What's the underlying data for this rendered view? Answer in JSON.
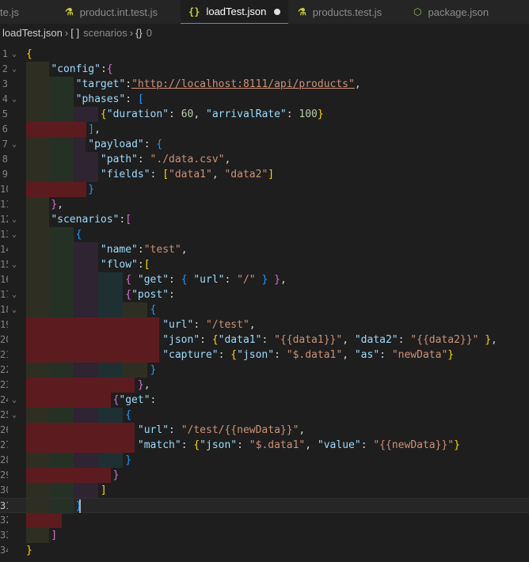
{
  "tabs": [
    {
      "label": "te.js",
      "icon": "js-file-icon"
    },
    {
      "label": "product.int.test.js",
      "icon": "test-flask-icon"
    },
    {
      "label": "loadTest.json",
      "icon": "json-braces-icon",
      "active": true,
      "modified": true
    },
    {
      "label": "products.test.js",
      "icon": "test-flask-icon"
    },
    {
      "label": "package.json",
      "icon": "npm-package-icon"
    }
  ],
  "breadcrumb": {
    "file": "loadTest.json",
    "scenarios_icon": "[ ]",
    "scenarios": "scenarios",
    "index_icon": "{}",
    "index": "0"
  },
  "editor": {
    "current_line": 31,
    "lines": [
      {
        "num": "1",
        "fold": "v",
        "tokens": [
          [
            "b1",
            "{"
          ]
        ]
      },
      {
        "num": "2",
        "fold": "v",
        "tokens": [
          [
            "sp",
            "    "
          ],
          [
            "k",
            "\"config\""
          ],
          [
            "p",
            ":"
          ],
          [
            "b2",
            "{"
          ]
        ]
      },
      {
        "num": "3",
        "fold": "",
        "tokens": [
          [
            "sp",
            "        "
          ],
          [
            "k",
            "\"target\""
          ],
          [
            "p",
            ":"
          ],
          [
            "u",
            "\"http://localhost:8111/api/products\""
          ],
          [
            "p",
            ","
          ]
        ]
      },
      {
        "num": "4",
        "fold": "v",
        "tokens": [
          [
            "sp",
            "        "
          ],
          [
            "k",
            "\"phases\""
          ],
          [
            "p",
            ": "
          ],
          [
            "b3",
            "["
          ]
        ]
      },
      {
        "num": "5",
        "fold": "",
        "tokens": [
          [
            "sp",
            "            "
          ],
          [
            "b1",
            "{"
          ],
          [
            "k",
            "\"duration\""
          ],
          [
            "p",
            ": "
          ],
          [
            "n",
            "60"
          ],
          [
            "p",
            ", "
          ],
          [
            "k",
            "\"arrivalRate\""
          ],
          [
            "p",
            ": "
          ],
          [
            "n",
            "100"
          ],
          [
            "b1",
            "}"
          ]
        ]
      },
      {
        "num": "6",
        "fold": "",
        "tokens": [
          [
            "sp",
            "          "
          ],
          [
            "b3",
            "]"
          ],
          [
            "p",
            ","
          ]
        ]
      },
      {
        "num": "7",
        "fold": "v",
        "tokens": [
          [
            "sp",
            "          "
          ],
          [
            "k",
            "\"payload\""
          ],
          [
            "p",
            ": "
          ],
          [
            "b3",
            "{"
          ]
        ]
      },
      {
        "num": "8",
        "fold": "",
        "tokens": [
          [
            "sp",
            "            "
          ],
          [
            "k",
            "\"path\""
          ],
          [
            "p",
            ": "
          ],
          [
            "s",
            "\"./data.csv\""
          ],
          [
            "p",
            ","
          ]
        ]
      },
      {
        "num": "9",
        "fold": "",
        "tokens": [
          [
            "sp",
            "            "
          ],
          [
            "k",
            "\"fields\""
          ],
          [
            "p",
            ": "
          ],
          [
            "b1",
            "["
          ],
          [
            "s",
            "\"data1\""
          ],
          [
            "p",
            ", "
          ],
          [
            "s",
            "\"data2\""
          ],
          [
            "b1",
            "]"
          ]
        ]
      },
      {
        "num": "10",
        "fold": "",
        "tokens": [
          [
            "sp",
            "          "
          ],
          [
            "b3",
            "}"
          ]
        ]
      },
      {
        "num": "11",
        "fold": "",
        "tokens": [
          [
            "sp",
            "    "
          ],
          [
            "b2",
            "}"
          ],
          [
            "p",
            ","
          ]
        ]
      },
      {
        "num": "12",
        "fold": "v",
        "tokens": [
          [
            "sp",
            "    "
          ],
          [
            "k",
            "\"scenarios\""
          ],
          [
            "p",
            ":"
          ],
          [
            "b2",
            "["
          ]
        ]
      },
      {
        "num": "13",
        "fold": "v",
        "tokens": [
          [
            "sp",
            "        "
          ],
          [
            "b3",
            "{"
          ]
        ]
      },
      {
        "num": "14",
        "fold": "",
        "tokens": [
          [
            "sp",
            "            "
          ],
          [
            "k",
            "\"name\""
          ],
          [
            "p",
            ":"
          ],
          [
            "s",
            "\"test\""
          ],
          [
            "p",
            ","
          ]
        ]
      },
      {
        "num": "15",
        "fold": "v",
        "tokens": [
          [
            "sp",
            "            "
          ],
          [
            "k",
            "\"flow\""
          ],
          [
            "p",
            ":"
          ],
          [
            "b1",
            "["
          ]
        ]
      },
      {
        "num": "16",
        "fold": "",
        "tokens": [
          [
            "sp",
            "                "
          ],
          [
            "b2",
            "{"
          ],
          [
            "p",
            " "
          ],
          [
            "k",
            "\"get\""
          ],
          [
            "p",
            ": "
          ],
          [
            "b3",
            "{"
          ],
          [
            "p",
            " "
          ],
          [
            "k",
            "\"url\""
          ],
          [
            "p",
            ": "
          ],
          [
            "s",
            "\"/\""
          ],
          [
            "p",
            " "
          ],
          [
            "b3",
            "}"
          ],
          [
            "p",
            " "
          ],
          [
            "b2",
            "}"
          ],
          [
            "p",
            ","
          ]
        ]
      },
      {
        "num": "17",
        "fold": "v",
        "tokens": [
          [
            "sp",
            "                "
          ],
          [
            "b2",
            "{"
          ],
          [
            "k",
            "\"post\""
          ],
          [
            "p",
            ":"
          ]
        ]
      },
      {
        "num": "18",
        "fold": "v",
        "tokens": [
          [
            "sp",
            "                    "
          ],
          [
            "b3",
            "{"
          ]
        ]
      },
      {
        "num": "19",
        "fold": "",
        "tokens": [
          [
            "sp",
            "                      "
          ],
          [
            "k",
            "\"url\""
          ],
          [
            "p",
            ": "
          ],
          [
            "s",
            "\"/test\""
          ],
          [
            "p",
            ","
          ]
        ]
      },
      {
        "num": "20",
        "fold": "",
        "tokens": [
          [
            "sp",
            "                      "
          ],
          [
            "k",
            "\"json\""
          ],
          [
            "p",
            ": "
          ],
          [
            "b1",
            "{"
          ],
          [
            "k",
            "\"data1\""
          ],
          [
            "p",
            ": "
          ],
          [
            "s",
            "\"{{data1}}\""
          ],
          [
            "p",
            ", "
          ],
          [
            "k",
            "\"data2\""
          ],
          [
            "p",
            ": "
          ],
          [
            "s",
            "\"{{data2}}\""
          ],
          [
            "p",
            " "
          ],
          [
            "b1",
            "}"
          ],
          [
            "p",
            ","
          ]
        ]
      },
      {
        "num": "21",
        "fold": "",
        "tokens": [
          [
            "sp",
            "                      "
          ],
          [
            "k",
            "\"capture\""
          ],
          [
            "p",
            ": "
          ],
          [
            "b1",
            "{"
          ],
          [
            "k",
            "\"json\""
          ],
          [
            "p",
            ": "
          ],
          [
            "s",
            "\"$.data1\""
          ],
          [
            "p",
            ", "
          ],
          [
            "k",
            "\"as\""
          ],
          [
            "p",
            ": "
          ],
          [
            "s",
            "\"newData\""
          ],
          [
            "b1",
            "}"
          ]
        ]
      },
      {
        "num": "22",
        "fold": "",
        "tokens": [
          [
            "sp",
            "                    "
          ],
          [
            "b3",
            "}"
          ]
        ]
      },
      {
        "num": "23",
        "fold": "",
        "tokens": [
          [
            "sp",
            "                  "
          ],
          [
            "b2",
            "}"
          ],
          [
            "p",
            ","
          ]
        ]
      },
      {
        "num": "24",
        "fold": "v",
        "tokens": [
          [
            "sp",
            "              "
          ],
          [
            "b2",
            "{"
          ],
          [
            "k",
            "\"get\""
          ],
          [
            "p",
            ":"
          ]
        ]
      },
      {
        "num": "25",
        "fold": "v",
        "tokens": [
          [
            "sp",
            "                "
          ],
          [
            "b3",
            "{"
          ]
        ]
      },
      {
        "num": "26",
        "fold": "",
        "tokens": [
          [
            "sp",
            "                  "
          ],
          [
            "k",
            "\"url\""
          ],
          [
            "p",
            ": "
          ],
          [
            "s",
            "\"/test/{{newData}}\""
          ],
          [
            "p",
            ","
          ]
        ]
      },
      {
        "num": "27",
        "fold": "",
        "tokens": [
          [
            "sp",
            "                  "
          ],
          [
            "k",
            "\"match\""
          ],
          [
            "p",
            ": "
          ],
          [
            "b1",
            "{"
          ],
          [
            "k",
            "\"json\""
          ],
          [
            "p",
            ": "
          ],
          [
            "s",
            "\"$.data1\""
          ],
          [
            "p",
            ", "
          ],
          [
            "k",
            "\"value\""
          ],
          [
            "p",
            ": "
          ],
          [
            "s",
            "\"{{newData}}\""
          ],
          [
            "b1",
            "}"
          ]
        ]
      },
      {
        "num": "28",
        "fold": "",
        "tokens": [
          [
            "sp",
            "                "
          ],
          [
            "b3",
            "}"
          ]
        ]
      },
      {
        "num": "29",
        "fold": "",
        "tokens": [
          [
            "sp",
            "              "
          ],
          [
            "b2",
            "}"
          ]
        ]
      },
      {
        "num": "30",
        "fold": "",
        "tokens": [
          [
            "sp",
            "            "
          ],
          [
            "b1",
            "]"
          ]
        ]
      },
      {
        "num": "31",
        "fold": "",
        "tokens": [
          [
            "sp",
            "        "
          ],
          [
            "b3",
            "}"
          ]
        ]
      },
      {
        "num": "32",
        "fold": "",
        "tokens": []
      },
      {
        "num": "33",
        "fold": "",
        "tokens": [
          [
            "sp",
            "    "
          ],
          [
            "b2",
            "]"
          ]
        ]
      },
      {
        "num": "34",
        "fold": "",
        "tokens": [
          [
            "b1",
            "}"
          ]
        ]
      }
    ]
  },
  "colors": {
    "indent_yellow": "#2e2f22",
    "indent_green": "#263126",
    "indent_purple": "#2f2432",
    "indent_teal": "#1f3033",
    "indent_error": "#5c1c1f"
  }
}
